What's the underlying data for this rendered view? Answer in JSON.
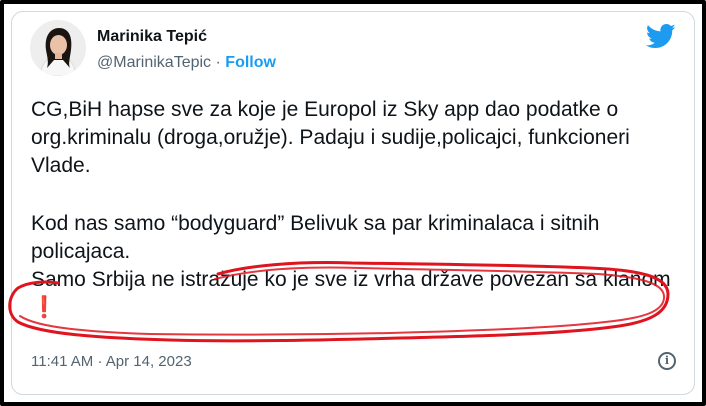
{
  "author": {
    "name": "Marinika Tepić",
    "handle": "@MarinikaTepic",
    "separator": "·",
    "follow_label": "Follow"
  },
  "tweet": {
    "paragraph_1": "CG,BiH hapse sve za koje je Europol iz Sky app dao podatke o org.kriminalu (droga,oružje). Padaju i sudije,policajci, funkcioneri Vlade.",
    "paragraph_2": "Kod nas samo “bodyguard” Belivuk sa par kriminalaca i sitnih policajaca.",
    "paragraph_3": "Samo Srbija ne istražuje ko je sve iz vrha države povezan sa klanom",
    "emoji": "❗"
  },
  "meta": {
    "time": "11:41 AM",
    "separator": "·",
    "date": "Apr 14, 2023",
    "info_glyph": "i"
  },
  "icons": {
    "logo": "twitter-bird-icon",
    "info": "info-icon"
  },
  "colors": {
    "link_blue": "#1d9bf0",
    "annotation_red": "#e0141e",
    "text_dark": "#0f1419",
    "text_gray": "#536471"
  }
}
